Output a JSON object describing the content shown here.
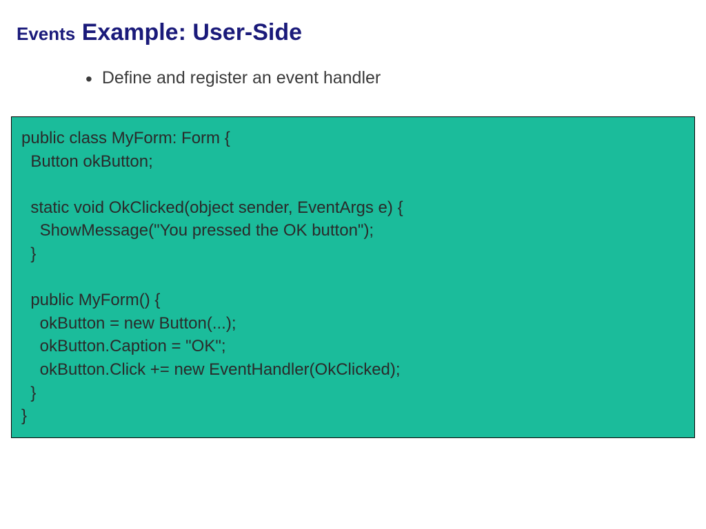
{
  "title": {
    "prefix": "Events",
    "main": " Example: User-Side"
  },
  "bullets": [
    "Define and register an event handler"
  ],
  "code": "public class MyForm: Form {\n  Button okButton;\n\n  static void OkClicked(object sender, EventArgs e) {\n    ShowMessage(\"You pressed the OK button\");\n  }\n\n  public MyForm() {\n    okButton = new Button(...);\n    okButton.Caption = \"OK\";\n    okButton.Click += new EventHandler(OkClicked);\n  }\n}",
  "colors": {
    "title": "#1a1a7a",
    "code_bg": "#1bbc9b",
    "text": "#3a3a3a"
  }
}
